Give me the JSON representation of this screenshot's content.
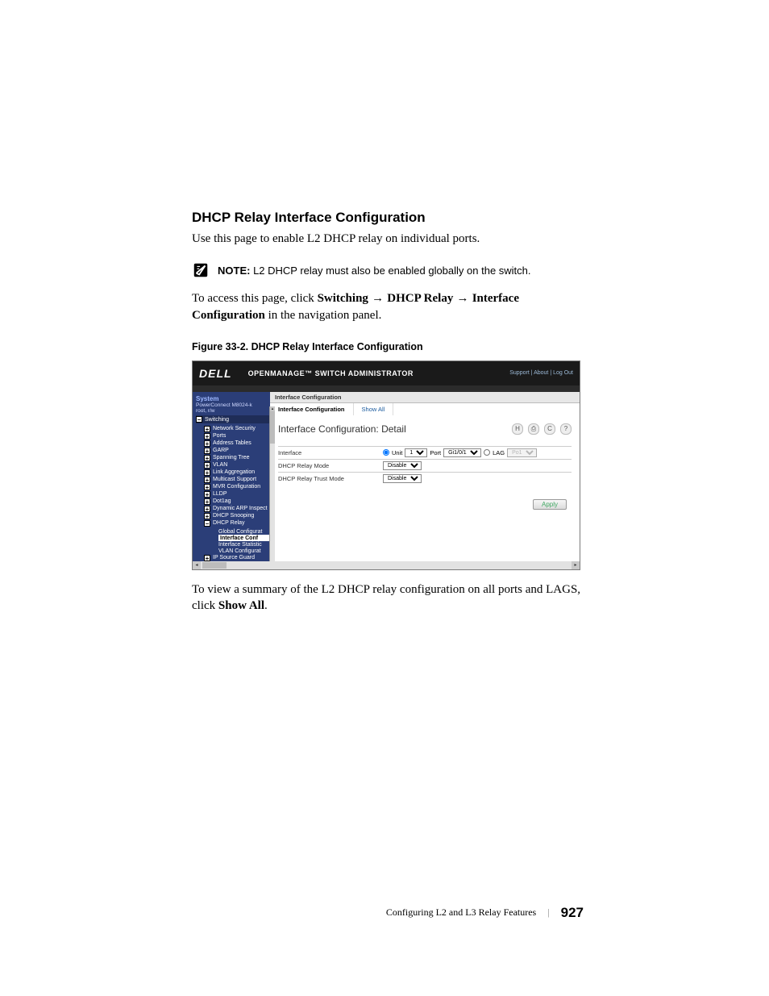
{
  "heading": "DHCP Relay Interface Configuration",
  "intro": "Use this page to enable L2 DHCP relay on individual ports.",
  "note": {
    "prefix": "NOTE:",
    "text": " L2 DHCP relay must also be enabled globally on the switch."
  },
  "access": {
    "lead": "To access this page, click ",
    "path1": "Switching",
    "arrow": " → ",
    "path2": "DHCP Relay",
    "path3": "Interface Configuration",
    "tail": " in the navigation panel."
  },
  "figure_caption": "Figure 33-2.    DHCP Relay Interface Configuration",
  "screenshot": {
    "logo": "DELL",
    "product_title": "OPENMANAGE™ SWITCH ADMINISTRATOR",
    "top_links": "Support  |  About  |  Log Out",
    "nav": {
      "system": "System",
      "device": "PowerConnect M8024-k",
      "user": "root, r/w",
      "switching": "Switching",
      "items": [
        "Network Security",
        "Ports",
        "Address Tables",
        "GARP",
        "Spanning Tree",
        "VLAN",
        "Link Aggregation",
        "Multicast Support",
        "MVR Configuration",
        "LLDP",
        "Dot1ag",
        "Dynamic ARP Inspect",
        "DHCP Snooping",
        "DHCP Relay"
      ],
      "dhcp_relay_children": [
        "Global Configurat",
        "Interface Conf",
        "Interface Statistic",
        "VLAN Configurat"
      ],
      "last_item": "IP Source Guard"
    },
    "breadcrumb": "Interface Configuration",
    "tabs": {
      "active": "Interface Configuration",
      "other": "Show All"
    },
    "panel_title": "Interface Configuration: Detail",
    "form": {
      "row1_label": "Interface",
      "row1_unit": "Unit",
      "row1_unit_val": "1",
      "row1_port": "Port",
      "row1_port_val": "Gi1/0/1",
      "row1_lag": "LAG",
      "row1_lag_val": "Po1",
      "row2_label": "DHCP Relay Mode",
      "row2_val": "Disable",
      "row3_label": "DHCP Relay Trust Mode",
      "row3_val": "Disable"
    },
    "apply": "Apply"
  },
  "post": {
    "lead": "To view a summary of the L2 DHCP relay configuration on all ports and LAGS, click ",
    "bold": "Show All",
    "tail": "."
  },
  "footer": {
    "label": "Configuring L2 and L3 Relay Features",
    "page": "927"
  }
}
